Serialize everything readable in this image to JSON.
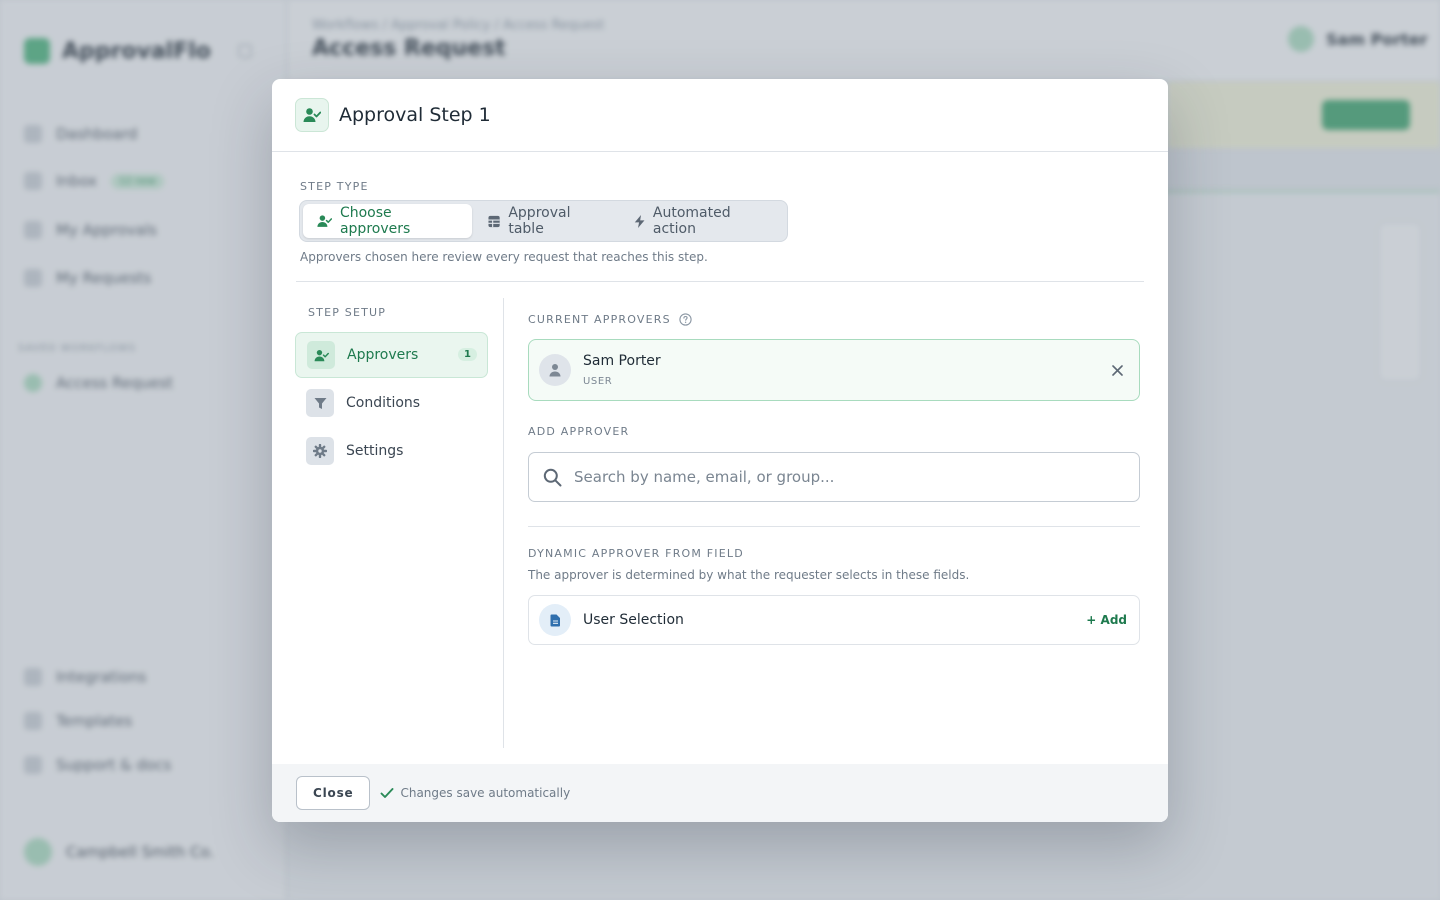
{
  "modal": {
    "title": "Approval Step 1",
    "step_type": {
      "label": "STEP TYPE",
      "options": [
        "Choose approvers",
        "Approval table",
        "Automated action"
      ],
      "selected": "Choose approvers",
      "hint": "Approvers chosen here review every request that reaches this step."
    },
    "setup": {
      "label": "STEP SETUP",
      "items": [
        {
          "label": "Approvers",
          "badge": "1",
          "icon": "user-check-icon"
        },
        {
          "label": "Conditions",
          "icon": "filter-icon"
        },
        {
          "label": "Settings",
          "icon": "gear-icon"
        }
      ]
    },
    "current_approvers": {
      "label": "CURRENT APPROVERS",
      "items": [
        {
          "name": "Sam Porter",
          "role": "USER"
        }
      ]
    },
    "add_approver": {
      "label": "ADD APPROVER",
      "placeholder": "Search by name, email, or group..."
    },
    "dynamic": {
      "label": "DYNAMIC APPROVER FROM FIELD",
      "hint": "The approver is determined by what the requester selects in these fields.",
      "fields": [
        {
          "name": "User Selection",
          "action": "+ Add"
        }
      ]
    },
    "footer": {
      "close_label": "Close",
      "save_note": "Changes save automatically"
    }
  },
  "background": {
    "app_name": "ApprovalFlo",
    "breadcrumbs": "Workflows   /   Approval Policy   /   Access Request",
    "page_title": "Access Request",
    "nav": [
      "Dashboard",
      "Inbox",
      "My Approvals",
      "My Requests"
    ],
    "nav_badge": "12 new",
    "section_label": "SAVED WORKFLOWS",
    "section_item": "Access Request",
    "bottom_nav": [
      "Integrations",
      "Templates",
      "Support & docs"
    ],
    "user_name": "Campbell Smith Co.",
    "header_user": "Sam Porter"
  },
  "colors": {
    "accent": "#1e7a4e",
    "accent_light": "#eaf6ef",
    "border": "#dfe3e8"
  }
}
